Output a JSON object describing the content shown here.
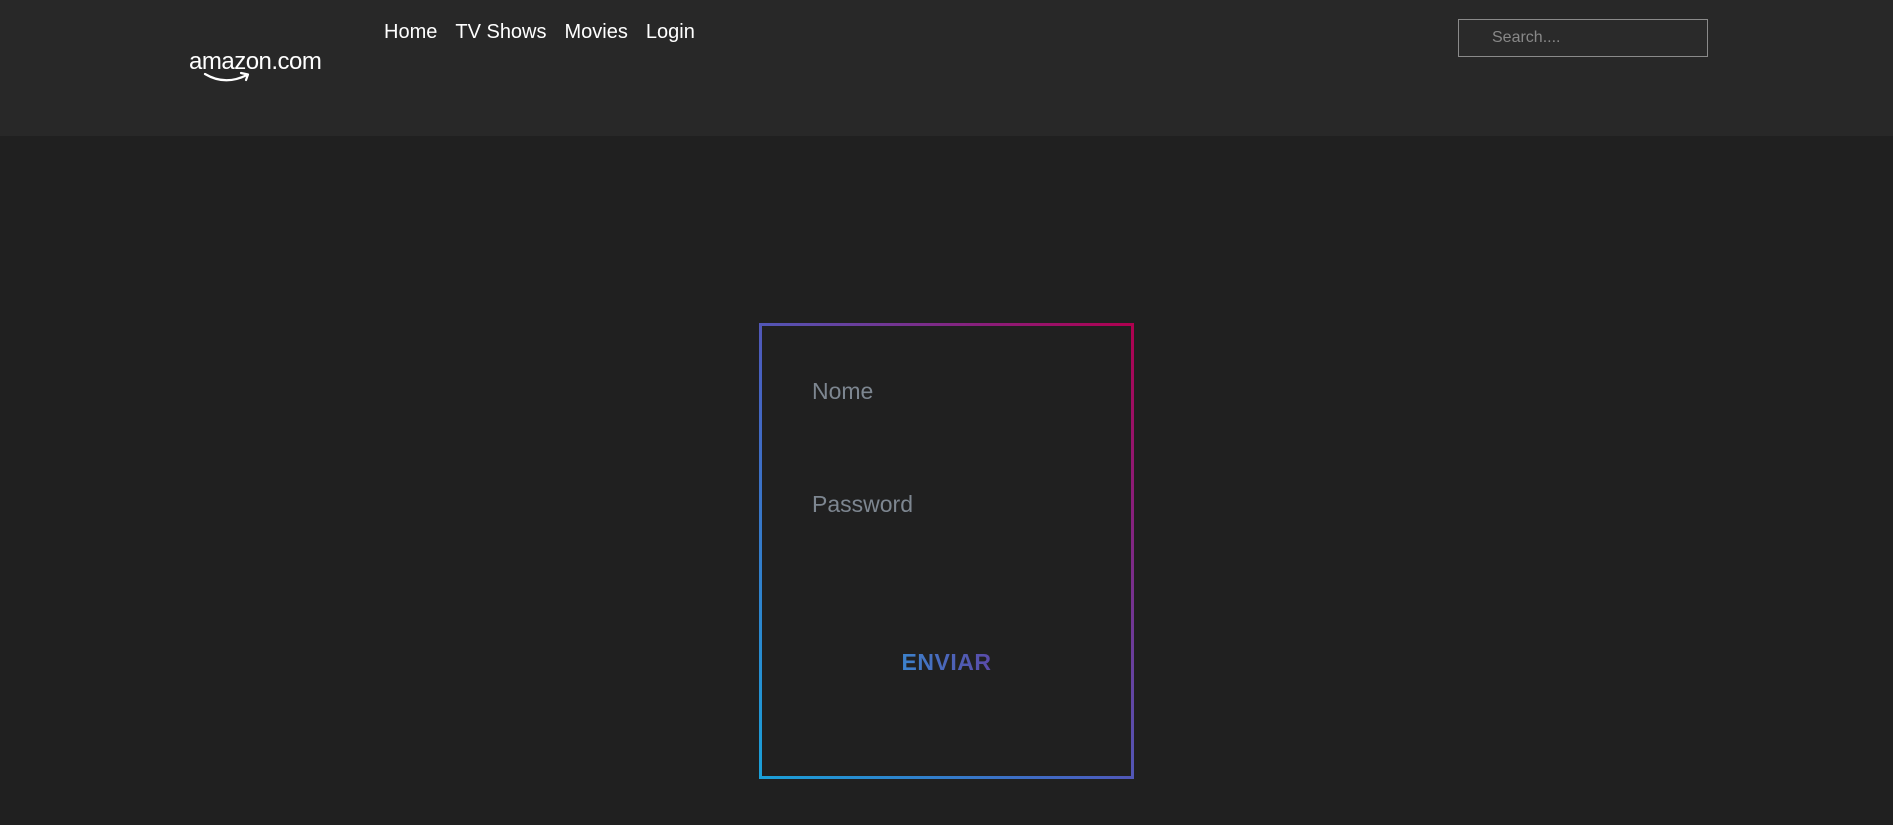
{
  "header": {
    "logo": {
      "text": "amazon.com"
    },
    "nav": [
      {
        "label": "Home"
      },
      {
        "label": "TV Shows"
      },
      {
        "label": "Movies"
      },
      {
        "label": "Login"
      }
    ],
    "search": {
      "placeholder": "Search....",
      "value": ""
    }
  },
  "login_form": {
    "name_field": {
      "placeholder": "Nome",
      "value": ""
    },
    "password_field": {
      "placeholder": "Password",
      "value": ""
    },
    "submit_label": "ENVIAR"
  },
  "colors": {
    "background": "#202020",
    "header_background": "#282828",
    "border_gradient_start": "#1aa0d8",
    "border_gradient_end": "#b0004e",
    "button_gradient_start": "#3c82cc",
    "button_gradient_end": "#5a4aa8"
  }
}
